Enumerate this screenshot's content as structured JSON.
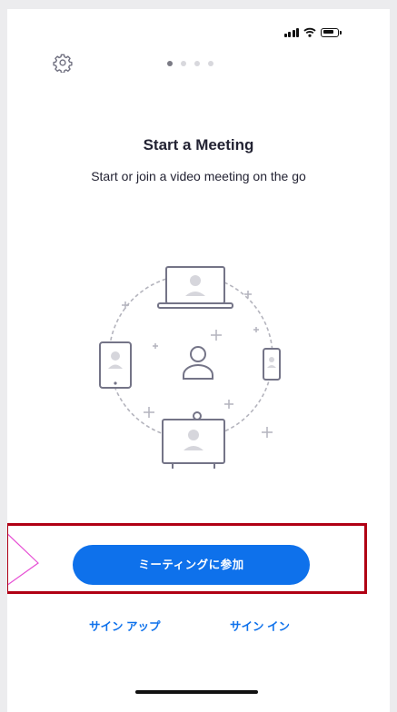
{
  "hero": {
    "title": "Start a Meeting",
    "subtitle": "Start or join a video meeting on the go"
  },
  "pager": {
    "pages": 4,
    "active_index": 0
  },
  "actions": {
    "join_button_label": "ミーティングに参加",
    "signup_label": "サイン アップ",
    "signin_label": "サイン イン"
  },
  "icons": {
    "settings": "gear-icon",
    "signal": "cellular-signal-icon",
    "wifi": "wifi-icon",
    "battery": "battery-icon"
  },
  "colors": {
    "accent": "#0e71eb",
    "text": "#232333",
    "highlight": "#b00014"
  }
}
